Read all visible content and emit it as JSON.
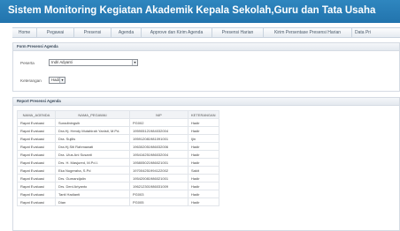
{
  "app": {
    "title": "Sistem Monitoring Kegiatan Akademik Kepala Sekolah,Guru dan Tata Usaha"
  },
  "nav": {
    "items": [
      "Home",
      "Pegawai",
      "Presensi",
      "Agenda",
      "Approve dan Kirim Agenda",
      "Presensi Harian",
      "Kirim Persentase Presensi Harian",
      "Data Pri"
    ]
  },
  "form": {
    "header": "Form Presensi Agenda",
    "peserta_label": "Peserta",
    "peserta_value": "Indri Adyanti",
    "keterangan_label": "Keterangan",
    "keterangan_value": "Hadir"
  },
  "report": {
    "header": "Report Presensi Agenda",
    "columns": [
      "NAMA_AGENDA",
      "NAMA_PEGAWAI",
      "NIP",
      "KETERANGAN"
    ],
    "rows": [
      [
        "Rapat Evaluasi",
        "Suradiningsih",
        "PG002",
        "Hadir"
      ],
      [
        "Rapat Evaluasi",
        "Dra.Hj. Hendy Mutahirah Yanisti, M.Pd.",
        "195905121984032004",
        "Hadir"
      ],
      [
        "Rapat Evaluasi",
        "Dra. Sujilis",
        "195912081981091001",
        "Ijin"
      ],
      [
        "Rapat Evaluasi",
        "Dra.Hj.Siti Rahmawati",
        "196302051986032006",
        "Hadir"
      ],
      [
        "Rapat Evaluasi",
        "Dra. Ulus Ani Susanti",
        "195416251986032004",
        "Hadir"
      ],
      [
        "Rapat Evaluasi",
        "Drs. H. Masjured, M.Pd.I.",
        "195805021986021001",
        "Hadir"
      ],
      [
        "Rapat Evaluasi",
        "Eka Nugeraha, S.Pd",
        "197004251994122002",
        "Sakit"
      ],
      [
        "Rapat Evaluasi",
        "Drs. Gumandjalin",
        "195420081986021001",
        "Hadir"
      ],
      [
        "Rapat Evaluasi",
        "Drs. Deni Ariyanto",
        "196212301986031009",
        "Hadir"
      ],
      [
        "Rapat Evaluasi",
        "Tanti Hadianti",
        "PG003",
        "Hadir"
      ],
      [
        "Rapat Evaluasi",
        "Dian",
        "PG005",
        "Hadir"
      ]
    ]
  }
}
